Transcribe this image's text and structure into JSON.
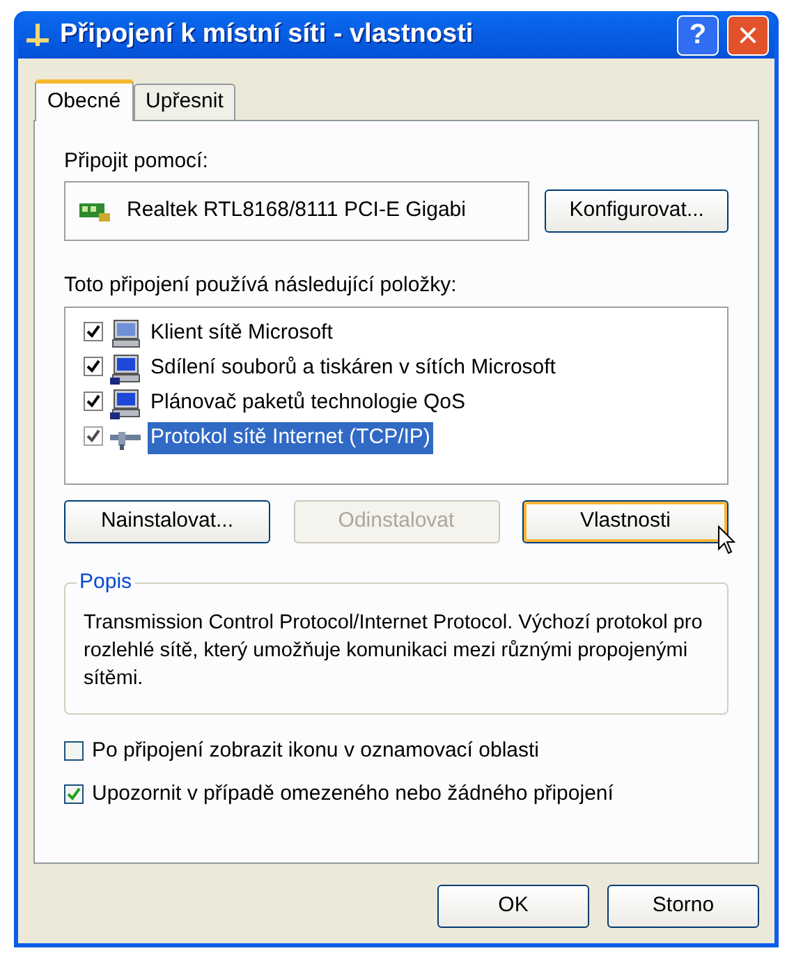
{
  "window": {
    "title": "Připojení k místní síti - vlastnosti",
    "help": "?",
    "close": "×"
  },
  "tabs": [
    {
      "label": "Obecné",
      "selected": true
    },
    {
      "label": "Upřesnit",
      "selected": false
    }
  ],
  "connect_using": {
    "label": "Připojit pomocí:",
    "adapter": "Realtek RTL8168/8111 PCI-E Gigabi",
    "button": "Konfigurovat..."
  },
  "components": {
    "label": "Toto připojení používá následující položky:",
    "items": [
      {
        "label": "Klient sítě Microsoft",
        "checked": true,
        "selected": false,
        "kind": "client"
      },
      {
        "label": "Sdílení souborů a tiskáren v sítích Microsoft",
        "checked": true,
        "selected": false,
        "kind": "service"
      },
      {
        "label": "Plánovač paketů technologie QoS",
        "checked": true,
        "selected": false,
        "kind": "service"
      },
      {
        "label": "Protokol sítě Internet (TCP/IP)",
        "checked": true,
        "selected": true,
        "kind": "protocol"
      }
    ]
  },
  "buttons": [
    {
      "label": "Nainstalovat...",
      "disabled": false,
      "hovered": false
    },
    {
      "label": "Odinstalovat",
      "disabled": true,
      "hovered": false
    },
    {
      "label": "Vlastnosti",
      "disabled": false,
      "hovered": true
    }
  ],
  "description": {
    "legend": "Popis",
    "text": "Transmission Control Protocol/Internet Protocol. Výchozí protokol pro rozlehlé sítě, který umožňuje komunikaci mezi různými propojenými sítěmi."
  },
  "options": [
    {
      "label": "Po připojení zobrazit ikonu v oznamovací oblasti",
      "checked": false
    },
    {
      "label": "Upozornit v případě omezeného nebo žádného připojení",
      "checked": true
    }
  ],
  "footer_buttons": [
    "OK",
    "Storno"
  ]
}
